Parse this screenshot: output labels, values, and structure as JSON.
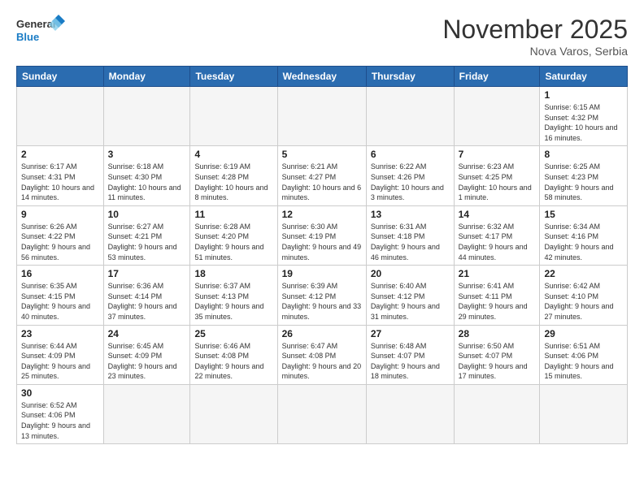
{
  "header": {
    "logo_text_general": "General",
    "logo_text_blue": "Blue",
    "month_title": "November 2025",
    "location": "Nova Varos, Serbia"
  },
  "weekdays": [
    "Sunday",
    "Monday",
    "Tuesday",
    "Wednesday",
    "Thursday",
    "Friday",
    "Saturday"
  ],
  "weeks": [
    [
      {
        "day": "",
        "info": ""
      },
      {
        "day": "",
        "info": ""
      },
      {
        "day": "",
        "info": ""
      },
      {
        "day": "",
        "info": ""
      },
      {
        "day": "",
        "info": ""
      },
      {
        "day": "",
        "info": ""
      },
      {
        "day": "1",
        "info": "Sunrise: 6:15 AM\nSunset: 4:32 PM\nDaylight: 10 hours\nand 16 minutes."
      }
    ],
    [
      {
        "day": "2",
        "info": "Sunrise: 6:17 AM\nSunset: 4:31 PM\nDaylight: 10 hours\nand 14 minutes."
      },
      {
        "day": "3",
        "info": "Sunrise: 6:18 AM\nSunset: 4:30 PM\nDaylight: 10 hours\nand 11 minutes."
      },
      {
        "day": "4",
        "info": "Sunrise: 6:19 AM\nSunset: 4:28 PM\nDaylight: 10 hours\nand 8 minutes."
      },
      {
        "day": "5",
        "info": "Sunrise: 6:21 AM\nSunset: 4:27 PM\nDaylight: 10 hours\nand 6 minutes."
      },
      {
        "day": "6",
        "info": "Sunrise: 6:22 AM\nSunset: 4:26 PM\nDaylight: 10 hours\nand 3 minutes."
      },
      {
        "day": "7",
        "info": "Sunrise: 6:23 AM\nSunset: 4:25 PM\nDaylight: 10 hours\nand 1 minute."
      },
      {
        "day": "8",
        "info": "Sunrise: 6:25 AM\nSunset: 4:23 PM\nDaylight: 9 hours\nand 58 minutes."
      }
    ],
    [
      {
        "day": "9",
        "info": "Sunrise: 6:26 AM\nSunset: 4:22 PM\nDaylight: 9 hours\nand 56 minutes."
      },
      {
        "day": "10",
        "info": "Sunrise: 6:27 AM\nSunset: 4:21 PM\nDaylight: 9 hours\nand 53 minutes."
      },
      {
        "day": "11",
        "info": "Sunrise: 6:28 AM\nSunset: 4:20 PM\nDaylight: 9 hours\nand 51 minutes."
      },
      {
        "day": "12",
        "info": "Sunrise: 6:30 AM\nSunset: 4:19 PM\nDaylight: 9 hours\nand 49 minutes."
      },
      {
        "day": "13",
        "info": "Sunrise: 6:31 AM\nSunset: 4:18 PM\nDaylight: 9 hours\nand 46 minutes."
      },
      {
        "day": "14",
        "info": "Sunrise: 6:32 AM\nSunset: 4:17 PM\nDaylight: 9 hours\nand 44 minutes."
      },
      {
        "day": "15",
        "info": "Sunrise: 6:34 AM\nSunset: 4:16 PM\nDaylight: 9 hours\nand 42 minutes."
      }
    ],
    [
      {
        "day": "16",
        "info": "Sunrise: 6:35 AM\nSunset: 4:15 PM\nDaylight: 9 hours\nand 40 minutes."
      },
      {
        "day": "17",
        "info": "Sunrise: 6:36 AM\nSunset: 4:14 PM\nDaylight: 9 hours\nand 37 minutes."
      },
      {
        "day": "18",
        "info": "Sunrise: 6:37 AM\nSunset: 4:13 PM\nDaylight: 9 hours\nand 35 minutes."
      },
      {
        "day": "19",
        "info": "Sunrise: 6:39 AM\nSunset: 4:12 PM\nDaylight: 9 hours\nand 33 minutes."
      },
      {
        "day": "20",
        "info": "Sunrise: 6:40 AM\nSunset: 4:12 PM\nDaylight: 9 hours\nand 31 minutes."
      },
      {
        "day": "21",
        "info": "Sunrise: 6:41 AM\nSunset: 4:11 PM\nDaylight: 9 hours\nand 29 minutes."
      },
      {
        "day": "22",
        "info": "Sunrise: 6:42 AM\nSunset: 4:10 PM\nDaylight: 9 hours\nand 27 minutes."
      }
    ],
    [
      {
        "day": "23",
        "info": "Sunrise: 6:44 AM\nSunset: 4:09 PM\nDaylight: 9 hours\nand 25 minutes."
      },
      {
        "day": "24",
        "info": "Sunrise: 6:45 AM\nSunset: 4:09 PM\nDaylight: 9 hours\nand 23 minutes."
      },
      {
        "day": "25",
        "info": "Sunrise: 6:46 AM\nSunset: 4:08 PM\nDaylight: 9 hours\nand 22 minutes."
      },
      {
        "day": "26",
        "info": "Sunrise: 6:47 AM\nSunset: 4:08 PM\nDaylight: 9 hours\nand 20 minutes."
      },
      {
        "day": "27",
        "info": "Sunrise: 6:48 AM\nSunset: 4:07 PM\nDaylight: 9 hours\nand 18 minutes."
      },
      {
        "day": "28",
        "info": "Sunrise: 6:50 AM\nSunset: 4:07 PM\nDaylight: 9 hours\nand 17 minutes."
      },
      {
        "day": "29",
        "info": "Sunrise: 6:51 AM\nSunset: 4:06 PM\nDaylight: 9 hours\nand 15 minutes."
      }
    ],
    [
      {
        "day": "30",
        "info": "Sunrise: 6:52 AM\nSunset: 4:06 PM\nDaylight: 9 hours\nand 13 minutes."
      },
      {
        "day": "",
        "info": ""
      },
      {
        "day": "",
        "info": ""
      },
      {
        "day": "",
        "info": ""
      },
      {
        "day": "",
        "info": ""
      },
      {
        "day": "",
        "info": ""
      },
      {
        "day": "",
        "info": ""
      }
    ]
  ]
}
